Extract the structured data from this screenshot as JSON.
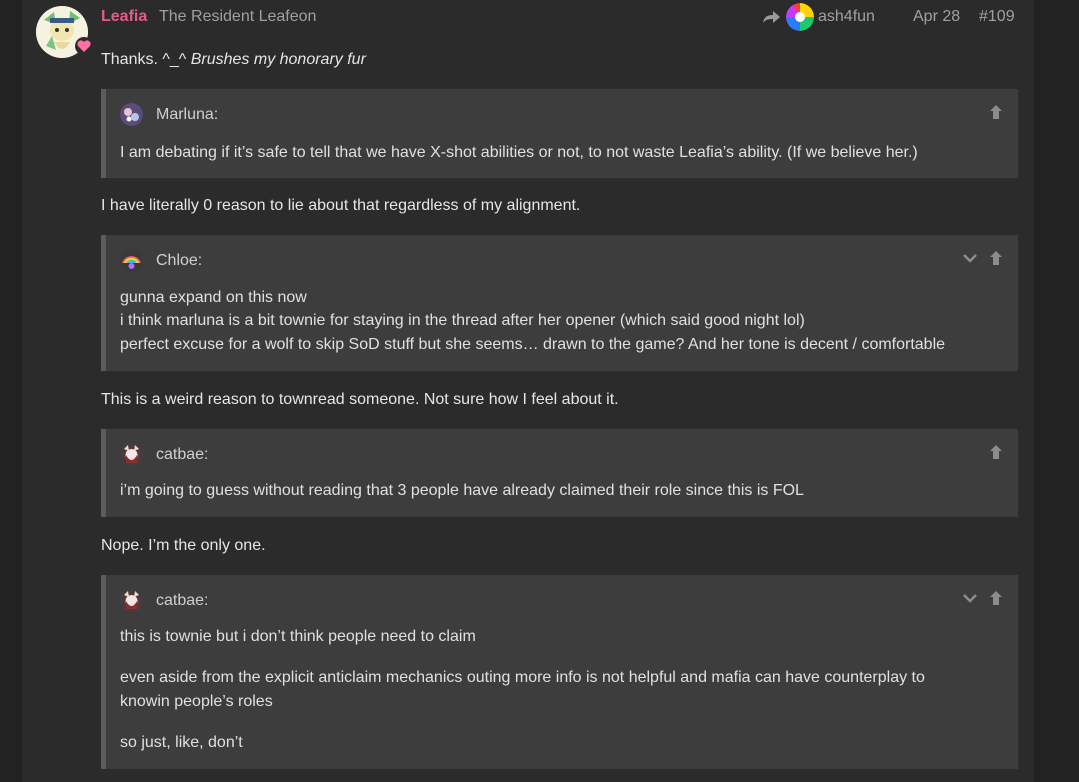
{
  "post": {
    "username": "Leafia",
    "user_title": "The Resident Leafeon",
    "reply_to": "ash4fun",
    "date": "Apr 28",
    "number": "#109",
    "intro_plain": "Thanks. ^_^ ",
    "intro_italic": "Brushes my honorary fur"
  },
  "quotes": [
    {
      "author": "Marluna:",
      "lines": [
        "I am debating if it’s safe to tell that we have X-shot abilities or not, to not waste Leafia’s ability. (If we believe her.)"
      ]
    },
    {
      "author": "Chloe:",
      "lines": [
        "gunna expand on this now",
        "i think marluna is a bit townie for staying in the thread after her opener (which said good night lol)",
        "perfect excuse for a wolf to skip SoD stuff but she seems… drawn to the game? And her tone is decent / comfortable"
      ]
    },
    {
      "author": "catbae:",
      "lines": [
        "i’m going to guess without reading that 3 people have already claimed their role since this is FOL"
      ]
    },
    {
      "author": "catbae:",
      "lines": [
        "this is townie but i don’t think people need to claim",
        "even aside from the explicit anticlaim mechanics outing more info is not helpful and mafia can have counterplay to",
        "knowin people’s roles",
        "so just, like, don’t"
      ]
    }
  ],
  "replies": [
    "I have literally 0 reason to lie about that regardless of my alignment.",
    "This is a weird reason to townread someone. Not sure how I feel about it.",
    "Nope. I’m the only one."
  ],
  "colors": {
    "username": "#e45a8b",
    "muted": "#a0a0a0",
    "quote_bg": "#3d3d3d",
    "post_bg": "#2b2b2b"
  },
  "icons": [
    "reply-arrow-icon",
    "expand-chevron-icon",
    "jump-to-quote-icon",
    "heart-badge-icon"
  ]
}
